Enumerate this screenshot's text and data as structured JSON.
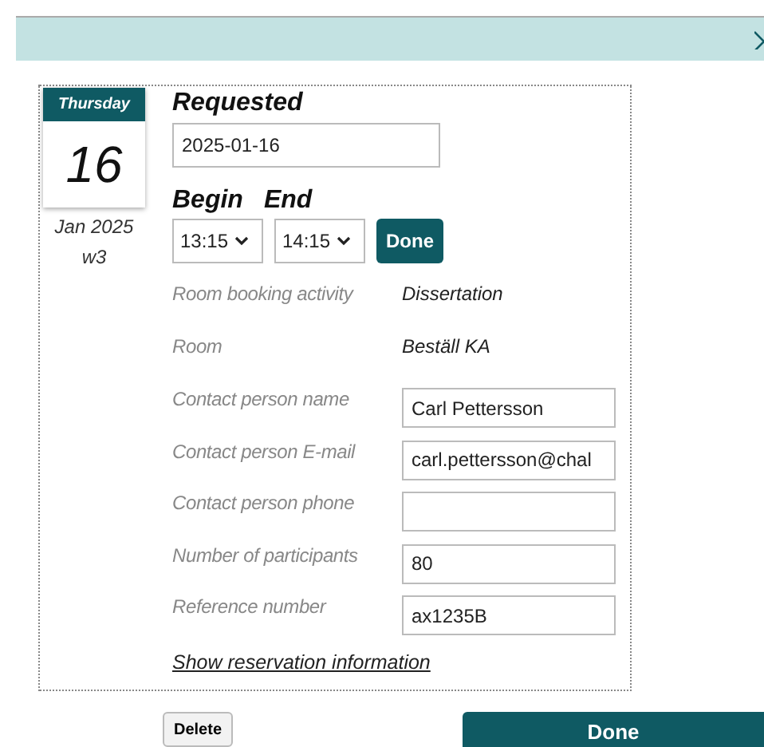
{
  "calendar": {
    "weekday": "Thursday",
    "day": "16",
    "month": "Jan 2025",
    "week": "w3"
  },
  "requested": {
    "label": "Requested",
    "value": "2025-01-16"
  },
  "time": {
    "begin_label": "Begin",
    "end_label": "End",
    "begin": "13:15",
    "end": "14:15",
    "button": "Done"
  },
  "fields": [
    {
      "kind": "text",
      "label": "Room booking activity",
      "value": "Dissertation"
    },
    {
      "kind": "text",
      "label": "Room",
      "value": "Beställ KA"
    },
    {
      "kind": "input",
      "label": "Contact person name",
      "value": "Carl Pettersson"
    },
    {
      "kind": "input",
      "label": "Contact person E-mail",
      "value": "carl.pettersson@chal"
    },
    {
      "kind": "input",
      "label": "Contact person phone"
    },
    {
      "kind": "input",
      "label": "Number of participants",
      "value": "80"
    },
    {
      "kind": "input",
      "label": "Reference number",
      "value": "ax1235B"
    }
  ],
  "link": "Show reservation information",
  "buttons": {
    "delete": "Delete",
    "done": "Done"
  }
}
